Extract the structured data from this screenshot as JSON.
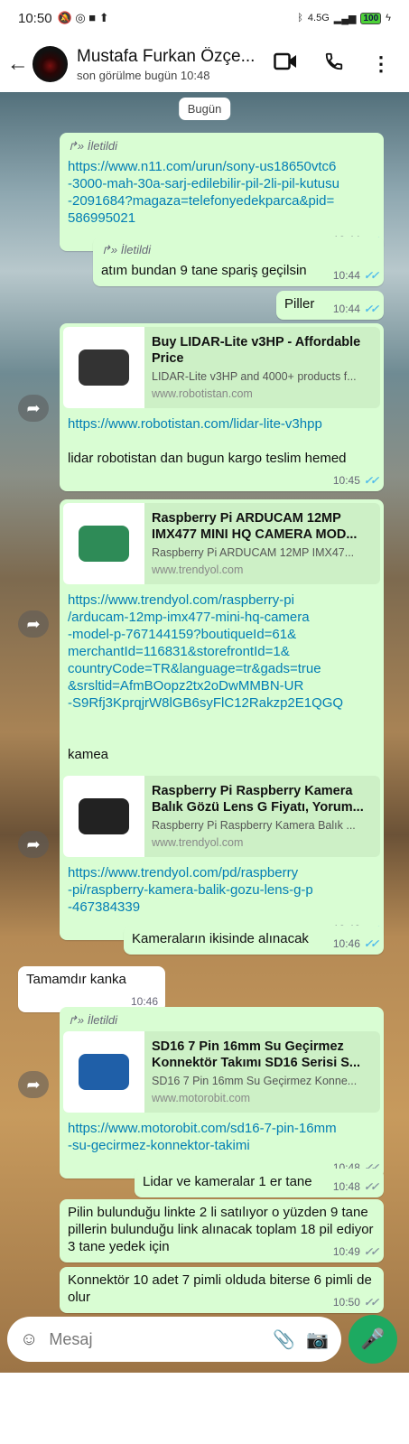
{
  "status_bar": {
    "time": "10:50",
    "network": "4.5G",
    "battery": "100"
  },
  "header": {
    "contact_name": "Mustafa Furkan Özçe...",
    "last_seen": "son görülme bugün 10:48",
    "icons": [
      "back-arrow-icon",
      "video-call-icon",
      "phone-icon",
      "more-vert-icon"
    ]
  },
  "date_chip": "Bugün",
  "forwarded_label": "İletildi",
  "messages": [
    {
      "dir": "out",
      "forwarded": true,
      "link_lines": [
        "https://www.n11.com/urun/sony-us18650vtc6",
        "-3000-mah-30a-sarj-edilebilir-pil-2li-pil-kutusu",
        "-2091684?magaza=telefonyedekparca&pid=",
        "586995021"
      ],
      "time": "10:44",
      "read": true
    },
    {
      "dir": "out",
      "forwarded": true,
      "text": "atım bundan 9 tane spariş geçilsin",
      "time": "10:44",
      "read": true
    },
    {
      "dir": "out",
      "text": "Piller",
      "time": "10:44",
      "read": true
    },
    {
      "dir": "out",
      "preview": {
        "title": "Buy LIDAR-Lite v3HP - Affordable Price",
        "desc": "LIDAR-Lite v3HP and 4000+ products f...",
        "domain": "www.robotistan.com"
      },
      "link_lines": [
        "https://www.robotistan.com/lidar-lite-v3hpp"
      ],
      "text": "lidar robotistan dan bugun kargo teslim hemed",
      "time": "10:45",
      "read": true,
      "share": true
    },
    {
      "dir": "out",
      "preview": {
        "title": "Raspberry Pi ARDUCAM 12MP IMX477 MINI HQ CAMERA MOD...",
        "desc": "Raspberry Pi ARDUCAM 12MP IMX47...",
        "domain": "www.trendyol.com"
      },
      "link_lines": [
        "https://www.trendyol.com/raspberry-pi",
        "/arducam-12mp-imx477-mini-hq-camera",
        "-model-p-767144159?boutiqueId=61&",
        "merchantId=116831&storefrontId=1&",
        "countryCode=TR&language=tr&gads=true",
        "&srsltid=AfmBOopz2tx2oDwMMBN-UR",
        "-S9Rfj3KprqjrW8lGB6syFlC12Rakzp2E1QGQ"
      ],
      "text": "kamea",
      "time": "10:46",
      "read": true,
      "share": true
    },
    {
      "dir": "out",
      "preview": {
        "title": "Raspberry Pi Raspberry Kamera Balık Gözü Lens G Fiyatı, Yorum...",
        "desc": "Raspberry Pi Raspberry Kamera Balık ...",
        "domain": "www.trendyol.com"
      },
      "link_lines": [
        "https://www.trendyol.com/pd/raspberry",
        "-pi/raspberry-kamera-balik-gozu-lens-g-p",
        "-467384339"
      ],
      "time": "10:46",
      "read": true,
      "share": true
    },
    {
      "dir": "out",
      "text": "Kameraların ikisinde alınacak",
      "time": "10:46",
      "read": true
    },
    {
      "dir": "in",
      "text": "Tamamdır kanka",
      "time": "10:46"
    },
    {
      "dir": "out",
      "forwarded": true,
      "preview": {
        "title": "SD16 7 Pin 16mm Su Geçirmez Konnektör Takımı SD16 Serisi S...",
        "desc": "SD16 7 Pin 16mm Su Geçirmez Konne...",
        "domain": "www.motorobit.com"
      },
      "link_lines": [
        "https://www.motorobit.com/sd16-7-pin-16mm",
        "-su-gecirmez-konnektor-takimi"
      ],
      "time": "10:48",
      "read": false,
      "share": true
    },
    {
      "dir": "out",
      "text": "Lidar ve kameralar 1 er tane",
      "time": "10:48",
      "read": false
    },
    {
      "dir": "out",
      "text": "Pilin bulunduğu linkte 2 li satılıyor o yüzden 9 tane pillerin bulunduğu link alınacak toplam 18 pil ediyor 3 tane yedek için",
      "time": "10:49",
      "read": false
    },
    {
      "dir": "out",
      "text": "Konnektör 10 adet 7 pimli olduda biterse 6 pimli de olur",
      "time": "10:50",
      "read": false
    }
  ],
  "composer": {
    "placeholder": "Mesaj"
  },
  "colors": {
    "bubble_out": "#d9fdd3",
    "bubble_in": "#ffffff",
    "link": "#027eb5",
    "read_tick": "#53bdeb",
    "unread_tick": "#8696a0",
    "mic_button": "#1daa61"
  }
}
